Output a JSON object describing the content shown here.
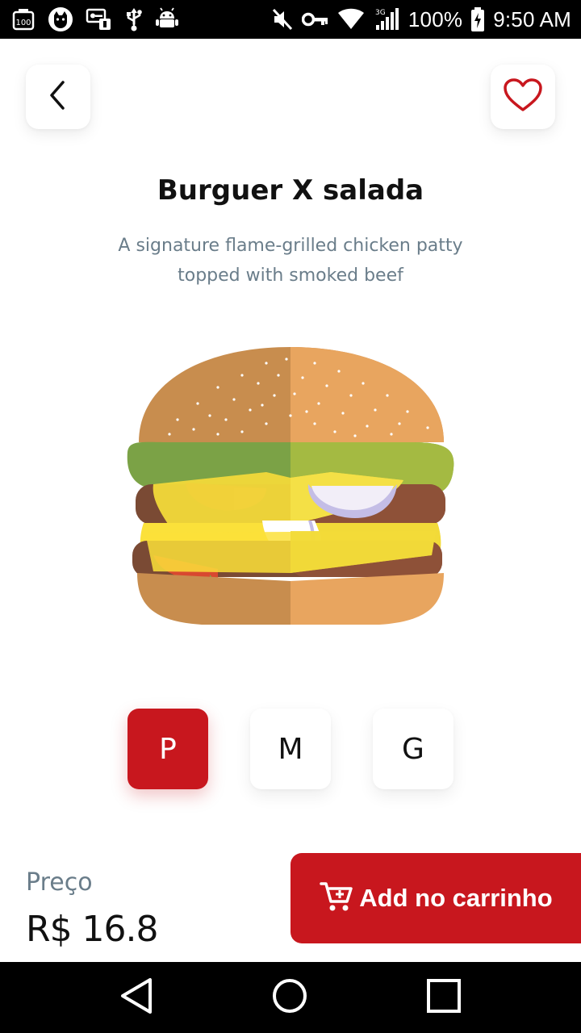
{
  "status_bar": {
    "battery_text": "100%",
    "time": "9:50 AM",
    "network_label": "3G",
    "badge_100": "100",
    "left_icons": [
      "badge-100-icon",
      "cat-icon",
      "vpn-key-icon",
      "usb-icon",
      "android-icon"
    ],
    "right_icons": [
      "mute-icon",
      "key-icon",
      "wifi-icon",
      "signal-icon",
      "battery-charging-icon"
    ]
  },
  "header": {
    "back_icon": "chevron-left-icon",
    "favorite_icon": "heart-outline-icon"
  },
  "product": {
    "title": "Burguer X salada",
    "description": "A signature flame-grilled chicken patty topped with smoked beef",
    "image": "burger-illustration"
  },
  "sizes": {
    "options": [
      "P",
      "M",
      "G"
    ],
    "selected": "P"
  },
  "price": {
    "label": "Preço",
    "value": "R$ 16.8"
  },
  "cart_button": {
    "label": "Add no carrinho",
    "icon": "cart-plus-icon"
  },
  "navigation": {
    "back": "triangle-back-icon",
    "home": "circle-home-icon",
    "recents": "square-recents-icon"
  },
  "colors": {
    "accent": "#c8171e",
    "muted_text": "#6a7d8a",
    "text": "#111111"
  }
}
